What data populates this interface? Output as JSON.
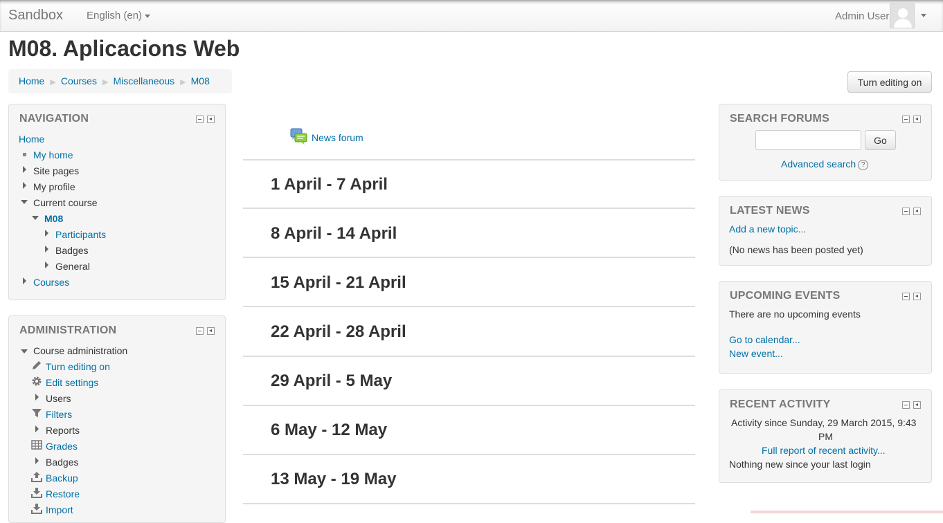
{
  "navbar": {
    "brand": "Sandbox",
    "language": "English (en)",
    "user_name": "Admin User"
  },
  "page": {
    "title": "M08. Aplicacions Web",
    "edit_button": "Turn editing on"
  },
  "breadcrumb": [
    "Home",
    "Courses",
    "Miscellaneous",
    "M08"
  ],
  "navigation": {
    "title": "NAVIGATION",
    "items": [
      {
        "label": "Home"
      },
      {
        "label": "My home"
      },
      {
        "label": "Site pages"
      },
      {
        "label": "My profile"
      },
      {
        "label": "Current course"
      },
      {
        "label": "M08"
      },
      {
        "label": "Participants"
      },
      {
        "label": "Badges"
      },
      {
        "label": "General"
      },
      {
        "label": "Courses"
      }
    ]
  },
  "administration": {
    "title": "ADMINISTRATION",
    "items": [
      {
        "label": "Course administration"
      },
      {
        "label": "Turn editing on",
        "icon": "pencil-icon"
      },
      {
        "label": "Edit settings",
        "icon": "gear-icon"
      },
      {
        "label": "Users"
      },
      {
        "label": "Filters",
        "icon": "filter-icon"
      },
      {
        "label": "Reports"
      },
      {
        "label": "Grades",
        "icon": "grid-icon"
      },
      {
        "label": "Badges"
      },
      {
        "label": "Backup",
        "icon": "upload-icon"
      },
      {
        "label": "Restore",
        "icon": "download-icon"
      },
      {
        "label": "Import",
        "icon": "download-icon"
      }
    ]
  },
  "main": {
    "forum_link": "News forum",
    "sections": [
      "1 April - 7 April",
      "8 April - 14 April",
      "15 April - 21 April",
      "22 April - 28 April",
      "29 April - 5 May",
      "6 May - 12 May",
      "13 May - 19 May"
    ]
  },
  "search_forums": {
    "title": "SEARCH FORUMS",
    "go": "Go",
    "advanced": "Advanced search"
  },
  "latest_news": {
    "title": "LATEST NEWS",
    "add_topic": "Add a new topic...",
    "empty": "(No news has been posted yet)"
  },
  "upcoming_events": {
    "title": "UPCOMING EVENTS",
    "empty": "There are no upcoming events",
    "calendar": "Go to calendar...",
    "new_event": "New event..."
  },
  "recent_activity": {
    "title": "RECENT ACTIVITY",
    "since_line1": "Activity since Sunday, 29 March 2015, 9:43",
    "since_line2": "PM",
    "full_report": "Full report of recent activity...",
    "nothing_new": "Nothing new since your last login"
  }
}
